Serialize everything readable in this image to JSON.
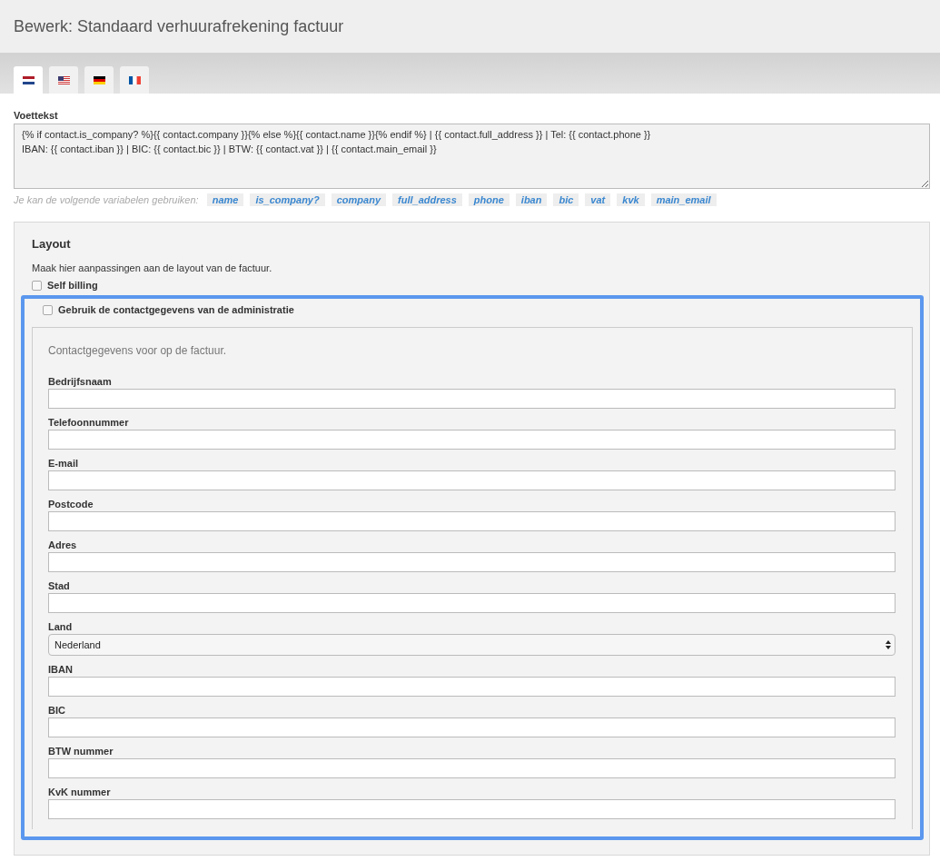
{
  "page_title": "Bewerk: Standaard verhuurafrekening factuur",
  "tabs": [
    {
      "kind": "nl",
      "selected": true
    },
    {
      "kind": "us",
      "selected": false
    },
    {
      "kind": "de",
      "selected": false
    },
    {
      "kind": "fr",
      "selected": false
    }
  ],
  "footer_text": {
    "label": "Voettekst",
    "value": "{% if contact.is_company? %}{{ contact.company }}{% else %}{{ contact.name }}{% endif %} | {{ contact.full_address }} | Tel: {{ contact.phone }}\nIBAN: {{ contact.iban }} | BIC: {{ contact.bic }} | BTW: {{ contact.vat }} | {{ contact.main_email }}",
    "hint": "Je kan de volgende variabelen gebruiken:",
    "variables": [
      "name",
      "is_company?",
      "company",
      "full_address",
      "phone",
      "iban",
      "bic",
      "vat",
      "kvk",
      "main_email"
    ]
  },
  "layout": {
    "heading": "Layout",
    "description": "Maak hier aanpassingen aan de layout van de factuur.",
    "self_billing": {
      "label": "Self billing",
      "checked": false
    },
    "use_admin_contact": {
      "label": "Gebruik de contactgegevens van de administratie",
      "checked": false
    },
    "contact_intro": "Contactgegevens voor op de factuur.",
    "fields": [
      {
        "label": "Bedrijfsnaam",
        "kind": "text"
      },
      {
        "label": "Telefoonnummer",
        "kind": "text"
      },
      {
        "label": "E-mail",
        "kind": "text"
      },
      {
        "label": "Postcode",
        "kind": "text"
      },
      {
        "label": "Adres",
        "kind": "text"
      },
      {
        "label": "Stad",
        "kind": "text"
      },
      {
        "label": "Land",
        "kind": "select",
        "value": "Nederland"
      },
      {
        "label": "IBAN",
        "kind": "text"
      },
      {
        "label": "BIC",
        "kind": "text"
      },
      {
        "label": "BTW nummer",
        "kind": "text"
      },
      {
        "label": "KvK nummer",
        "kind": "text"
      }
    ]
  }
}
